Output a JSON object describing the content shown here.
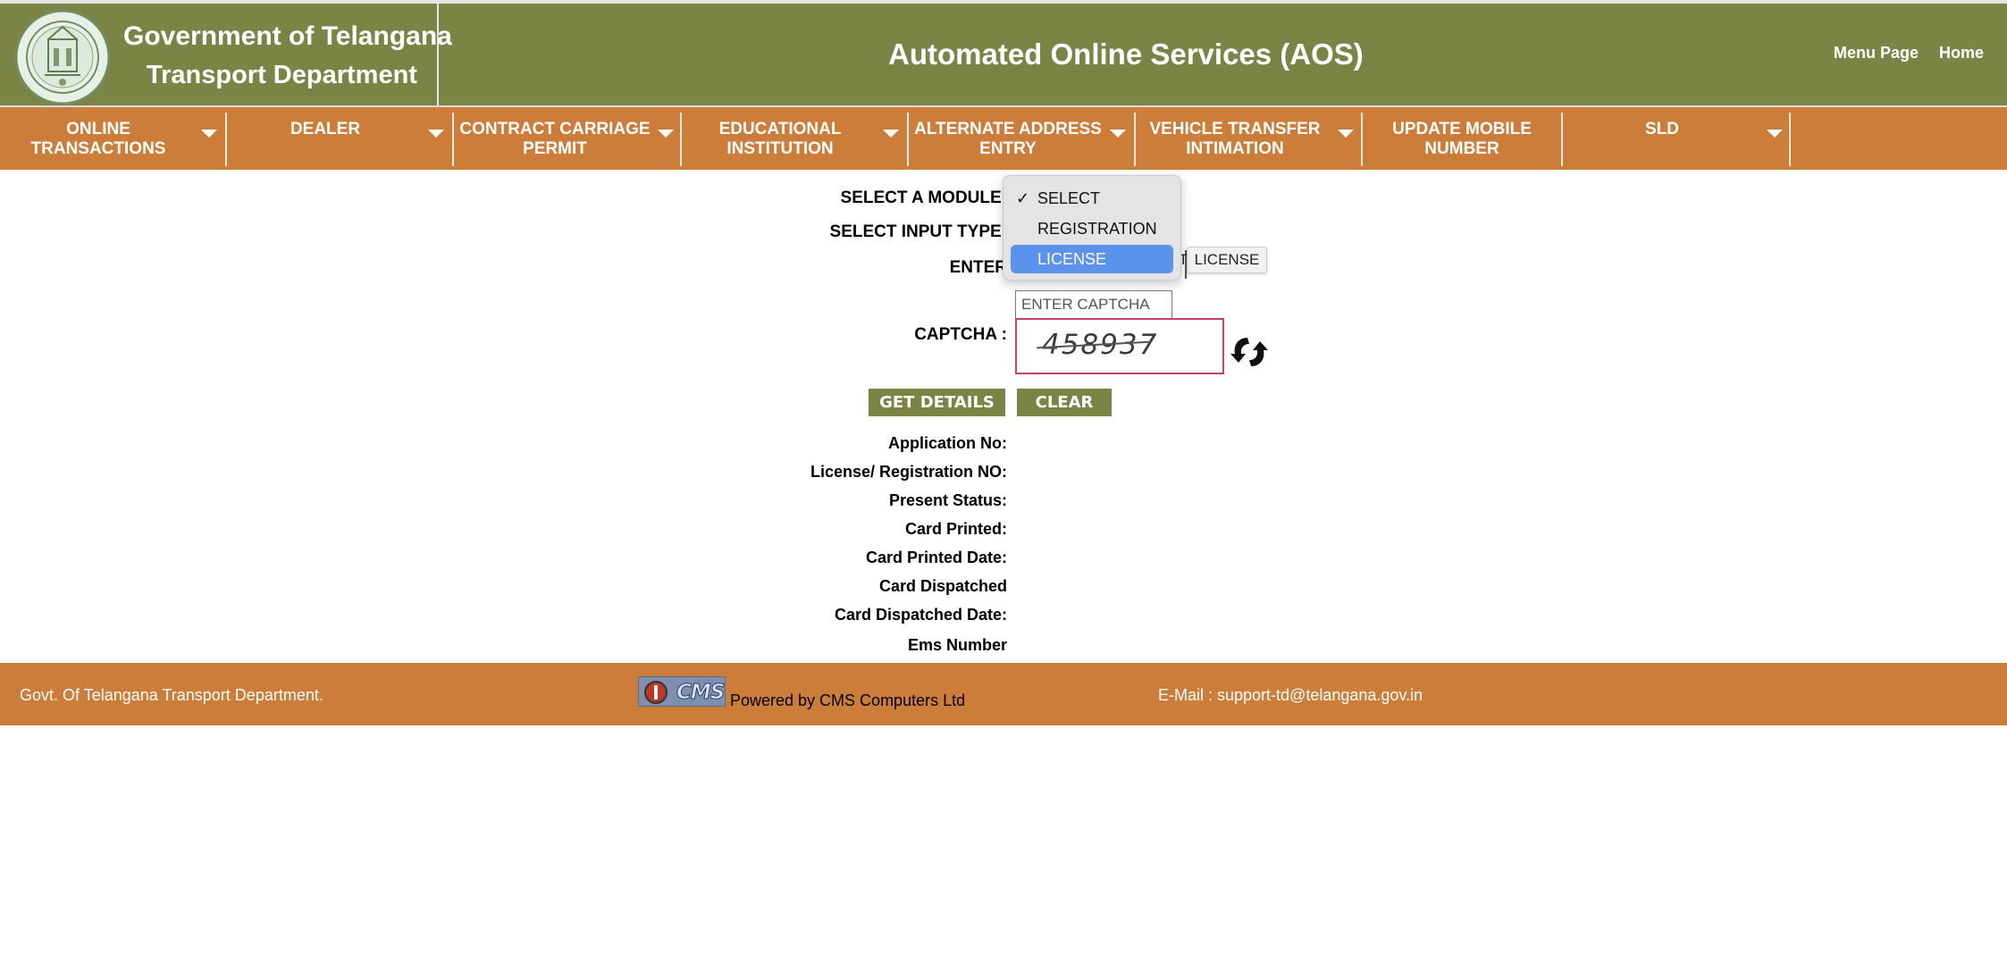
{
  "header": {
    "line1": "Government of Telangana",
    "line2": "Transport Department",
    "app_title": "Automated Online Services (AOS)",
    "links": {
      "menu_page": "Menu Page",
      "home": "Home"
    },
    "emblem_icon": "telangana-emblem-icon"
  },
  "nav": {
    "items": [
      {
        "label": "ONLINE\nTRANSACTIONS",
        "has_dropdown": true
      },
      {
        "label": "DEALER",
        "has_dropdown": true
      },
      {
        "label": "CONTRACT CARRIAGE\nPERMIT",
        "has_dropdown": true
      },
      {
        "label": "EDUCATIONAL\nINSTITUTION",
        "has_dropdown": true
      },
      {
        "label": "ALTERNATE ADDRESS\nENTRY",
        "has_dropdown": true
      },
      {
        "label": "VEHICLE TRANSFER\nINTIMATION",
        "has_dropdown": true
      },
      {
        "label": "UPDATE MOBILE\nNUMBER",
        "has_dropdown": false
      },
      {
        "label": "SLD",
        "has_dropdown": true
      }
    ]
  },
  "form": {
    "select_module_label": "SELECT A MODULE:",
    "select_input_type_label": "SELECT INPUT TYPE:",
    "enter_label": "ENTER",
    "module_dropdown": {
      "selected": "SELECT",
      "options": [
        "SELECT",
        "REGISTRATION",
        "LICENSE"
      ],
      "highlighted": "LICENSE"
    },
    "partial_button_text": "T",
    "license_button": "LICENSE",
    "captcha_placeholder": "ENTER CAPTCHA",
    "captcha_label": "CAPTCHA :",
    "captcha_value": "458937",
    "refresh_icon": "refresh-icon",
    "get_details_button": "GET DETAILS",
    "clear_button": "CLEAR"
  },
  "results": {
    "labels": [
      "Application No:",
      "License/ Registration NO:",
      "Present Status:",
      "Card Printed:",
      "Card Printed Date:",
      "Card Dispatched",
      "Card Dispatched Date:",
      "Ems Number"
    ]
  },
  "footer": {
    "left": "Govt. Of Telangana Transport Department.",
    "cms_logo_text": "CMS",
    "powered_by": "Powered by CMS Computers Ltd",
    "email": "E-Mail : support-td@telangana.gov.in"
  },
  "colors": {
    "header_bg": "#7b8445",
    "nav_bg": "#cc7d39",
    "footer_bg": "#cc7d39",
    "button_bg": "#7b8445",
    "dropdown_highlight": "#5b93ec",
    "captcha_border": "#c2416d"
  }
}
